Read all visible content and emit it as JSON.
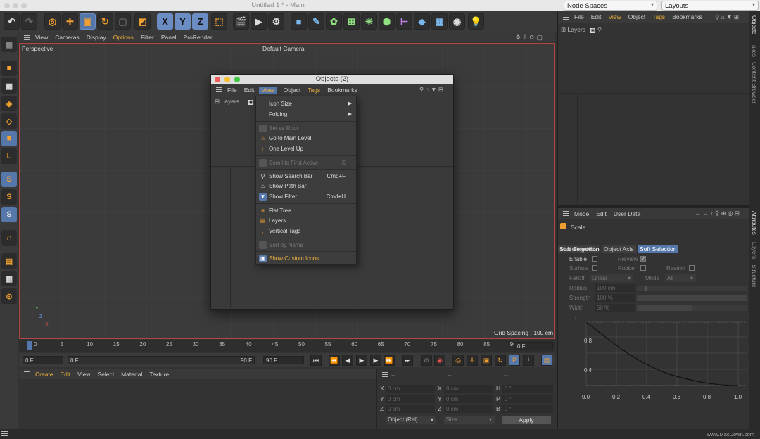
{
  "window": {
    "title": "Untitled 1 * - Main"
  },
  "top_dropdowns": {
    "node_spaces": "Node Spaces",
    "layouts": "Layouts"
  },
  "viewport_menu": [
    "View",
    "Cameras",
    "Display",
    "Options",
    "Filter",
    "Panel",
    "ProRender"
  ],
  "viewport": {
    "label": "Perspective",
    "camera": "Default Camera",
    "grid_spacing": "Grid Spacing : 100 cm",
    "axis_y": "Y",
    "axis_z": "Z",
    "axis_x": "X"
  },
  "timeline": {
    "ticks": [
      "0",
      "5",
      "10",
      "15",
      "20",
      "25",
      "30",
      "35",
      "40",
      "45",
      "50",
      "55",
      "60",
      "65",
      "70",
      "75",
      "80",
      "85",
      "90"
    ],
    "current_frame": "0 F",
    "start": "0 F",
    "min": "0 F",
    "max": "90 F",
    "end": "90 F"
  },
  "material_menu": [
    "Create",
    "Edit",
    "View",
    "Select",
    "Material",
    "Texture"
  ],
  "coords": {
    "dash1": "--",
    "dash2": "--",
    "dash3": "--",
    "rows": [
      {
        "a": "X",
        "av": "0 cm",
        "b": "X",
        "bv": "0 cm",
        "c": "H",
        "cv": "0 °"
      },
      {
        "a": "Y",
        "av": "0 cm",
        "b": "Y",
        "bv": "0 cm",
        "c": "P",
        "cv": "0 °"
      },
      {
        "a": "Z",
        "av": "0 cm",
        "b": "Z",
        "bv": "0 cm",
        "c": "B",
        "cv": "0 °"
      }
    ],
    "mode": "Object (Rel)",
    "size": "Size",
    "apply": "Apply"
  },
  "objects_panel": {
    "menu": [
      "File",
      "Edit",
      "View",
      "Object",
      "Tags",
      "Bookmarks"
    ],
    "layers": "Layers"
  },
  "attributes": {
    "menu": [
      "Mode",
      "Edit",
      "User Data"
    ],
    "object": "Scale",
    "tabs": [
      "Modeling Axis",
      "Object Axis",
      "Soft Selection"
    ],
    "section": "Soft Selection",
    "enable": "Enable",
    "preview": "Preview",
    "surface": "Surface",
    "rubber": "Rubber",
    "restrict": "Restrict",
    "falloff": "Falloff",
    "falloff_value": "Linear",
    "mode": "Mode",
    "mode_value": "All",
    "radius": "Radius",
    "radius_value": "100 cm",
    "strength": "Strength",
    "strength_value": "100 %",
    "width": "Width",
    "width_value": "50 %",
    "graph_x": [
      "0.0",
      "0.2",
      "0.4",
      "0.6",
      "0.8",
      "1.0"
    ],
    "graph_y": [
      "0.8",
      "0.4"
    ]
  },
  "right_tabs": {
    "objects": "Objects",
    "takes": "Takes",
    "content": "Content Browser",
    "attributes": "Attributes",
    "layers": "Layers",
    "structure": "Structure"
  },
  "objects_window": {
    "title": "Objects (2)",
    "menu": [
      "File",
      "Edit",
      "View",
      "Object",
      "Tags",
      "Bookmarks"
    ],
    "layers": "Layers"
  },
  "view_menu": {
    "icon_size": "Icon Size",
    "folding": "Folding",
    "set_as_root": "Set as Root",
    "go_main": "Go to Main Level",
    "one_level_up": "One Level Up",
    "scroll_first": "Scroll to First Active",
    "scroll_key": "S",
    "show_search": "Show Search Bar",
    "show_search_key": "Cmd+F",
    "show_path": "Show Path Bar",
    "show_filter": "Show Filter",
    "show_filter_key": "Cmd+U",
    "flat_tree": "Flat Tree",
    "layers": "Layers",
    "vertical_tags": "Vertical Tags",
    "sort_by_name": "Sort by Name",
    "show_custom_icons": "Show Custom Icons"
  },
  "watermark": "www.MacDown.com"
}
